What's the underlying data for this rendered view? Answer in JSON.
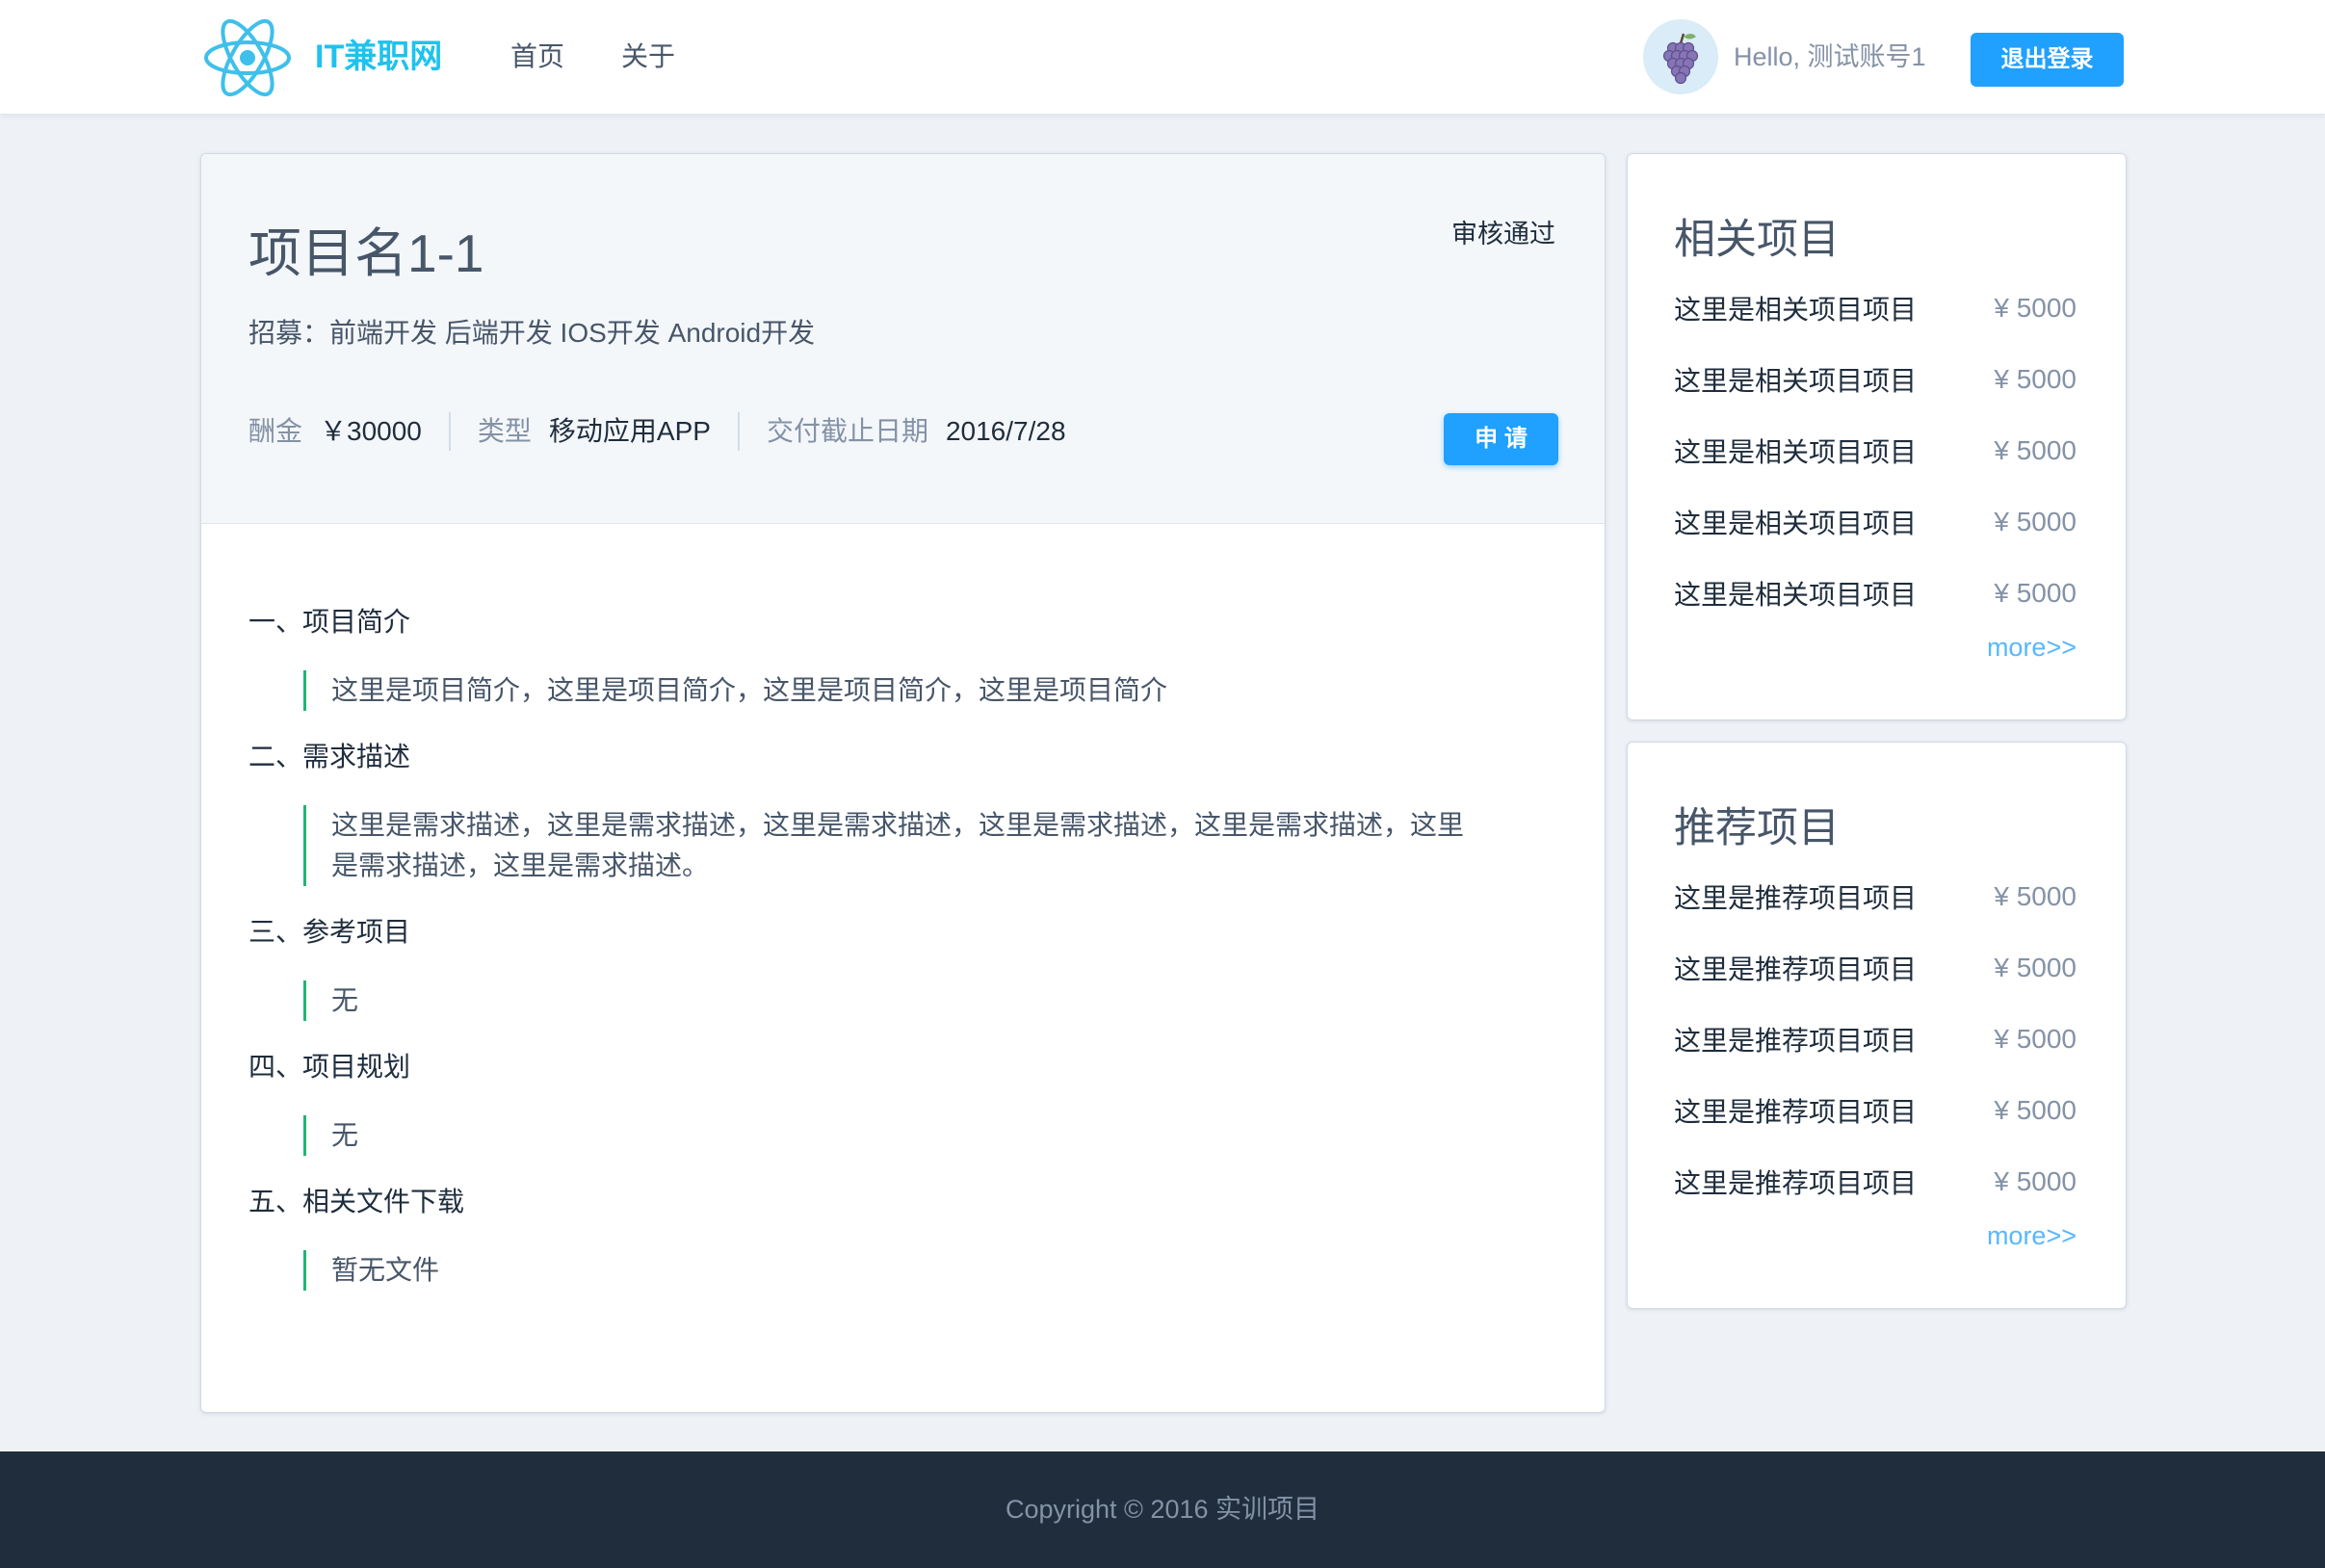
{
  "header": {
    "logo_icon": "react-atom-icon",
    "logo_text": "IT兼职网",
    "nav": [
      {
        "label": "首页"
      },
      {
        "label": "关于"
      }
    ],
    "avatar_icon": "grape-icon",
    "greeting": "Hello, 测试账号1",
    "logout_label": "退出登录"
  },
  "project": {
    "title": "项目名1-1",
    "status": "审核通过",
    "recruit": "招募：前端开发 后端开发 IOS开发 Android开发",
    "meta": [
      {
        "label": "酬金",
        "value": "￥30000"
      },
      {
        "label": "类型",
        "value": "移动应用APP"
      },
      {
        "label": "交付截止日期",
        "value": "2016/7/28"
      }
    ],
    "apply_label": "申 请",
    "sections": [
      {
        "heading": "一、项目简介",
        "body": "这里是项目简介，这里是项目简介，这里是项目简介，这里是项目简介"
      },
      {
        "heading": "二、需求描述",
        "body": "这里是需求描述，这里是需求描述，这里是需求描述，这里是需求描述，这里是需求描述，这里是需求描述，这里是需求描述。"
      },
      {
        "heading": "三、参考项目",
        "body": "无"
      },
      {
        "heading": "四、项目规划",
        "body": "无"
      },
      {
        "heading": "五、相关文件下载",
        "body": "暂无文件"
      }
    ]
  },
  "related": {
    "title": "相关项目",
    "items": [
      {
        "name": "这里是相关项目项目",
        "price": "¥ 5000"
      },
      {
        "name": "这里是相关项目项目",
        "price": "¥ 5000"
      },
      {
        "name": "这里是相关项目项目",
        "price": "¥ 5000"
      },
      {
        "name": "这里是相关项目项目",
        "price": "¥ 5000"
      },
      {
        "name": "这里是相关项目项目",
        "price": "¥ 5000"
      }
    ],
    "more_label": "more>>"
  },
  "recommended": {
    "title": "推荐项目",
    "items": [
      {
        "name": "这里是推荐项目项目",
        "price": "¥ 5000"
      },
      {
        "name": "这里是推荐项目项目",
        "price": "¥ 5000"
      },
      {
        "name": "这里是推荐项目项目",
        "price": "¥ 5000"
      },
      {
        "name": "这里是推荐项目项目",
        "price": "¥ 5000"
      },
      {
        "name": "这里是推荐项目项目",
        "price": "¥ 5000"
      }
    ],
    "more_label": "more>>"
  },
  "footer": {
    "copyright": "Copyright © 2016 实训项目"
  },
  "colors": {
    "brand": "#20a0ff",
    "logo": "#1fc2ec",
    "quote_border": "#20b574",
    "link": "#58b7ff",
    "footer_bg": "#1f2d3d",
    "page_bg": "#eef1f6"
  }
}
